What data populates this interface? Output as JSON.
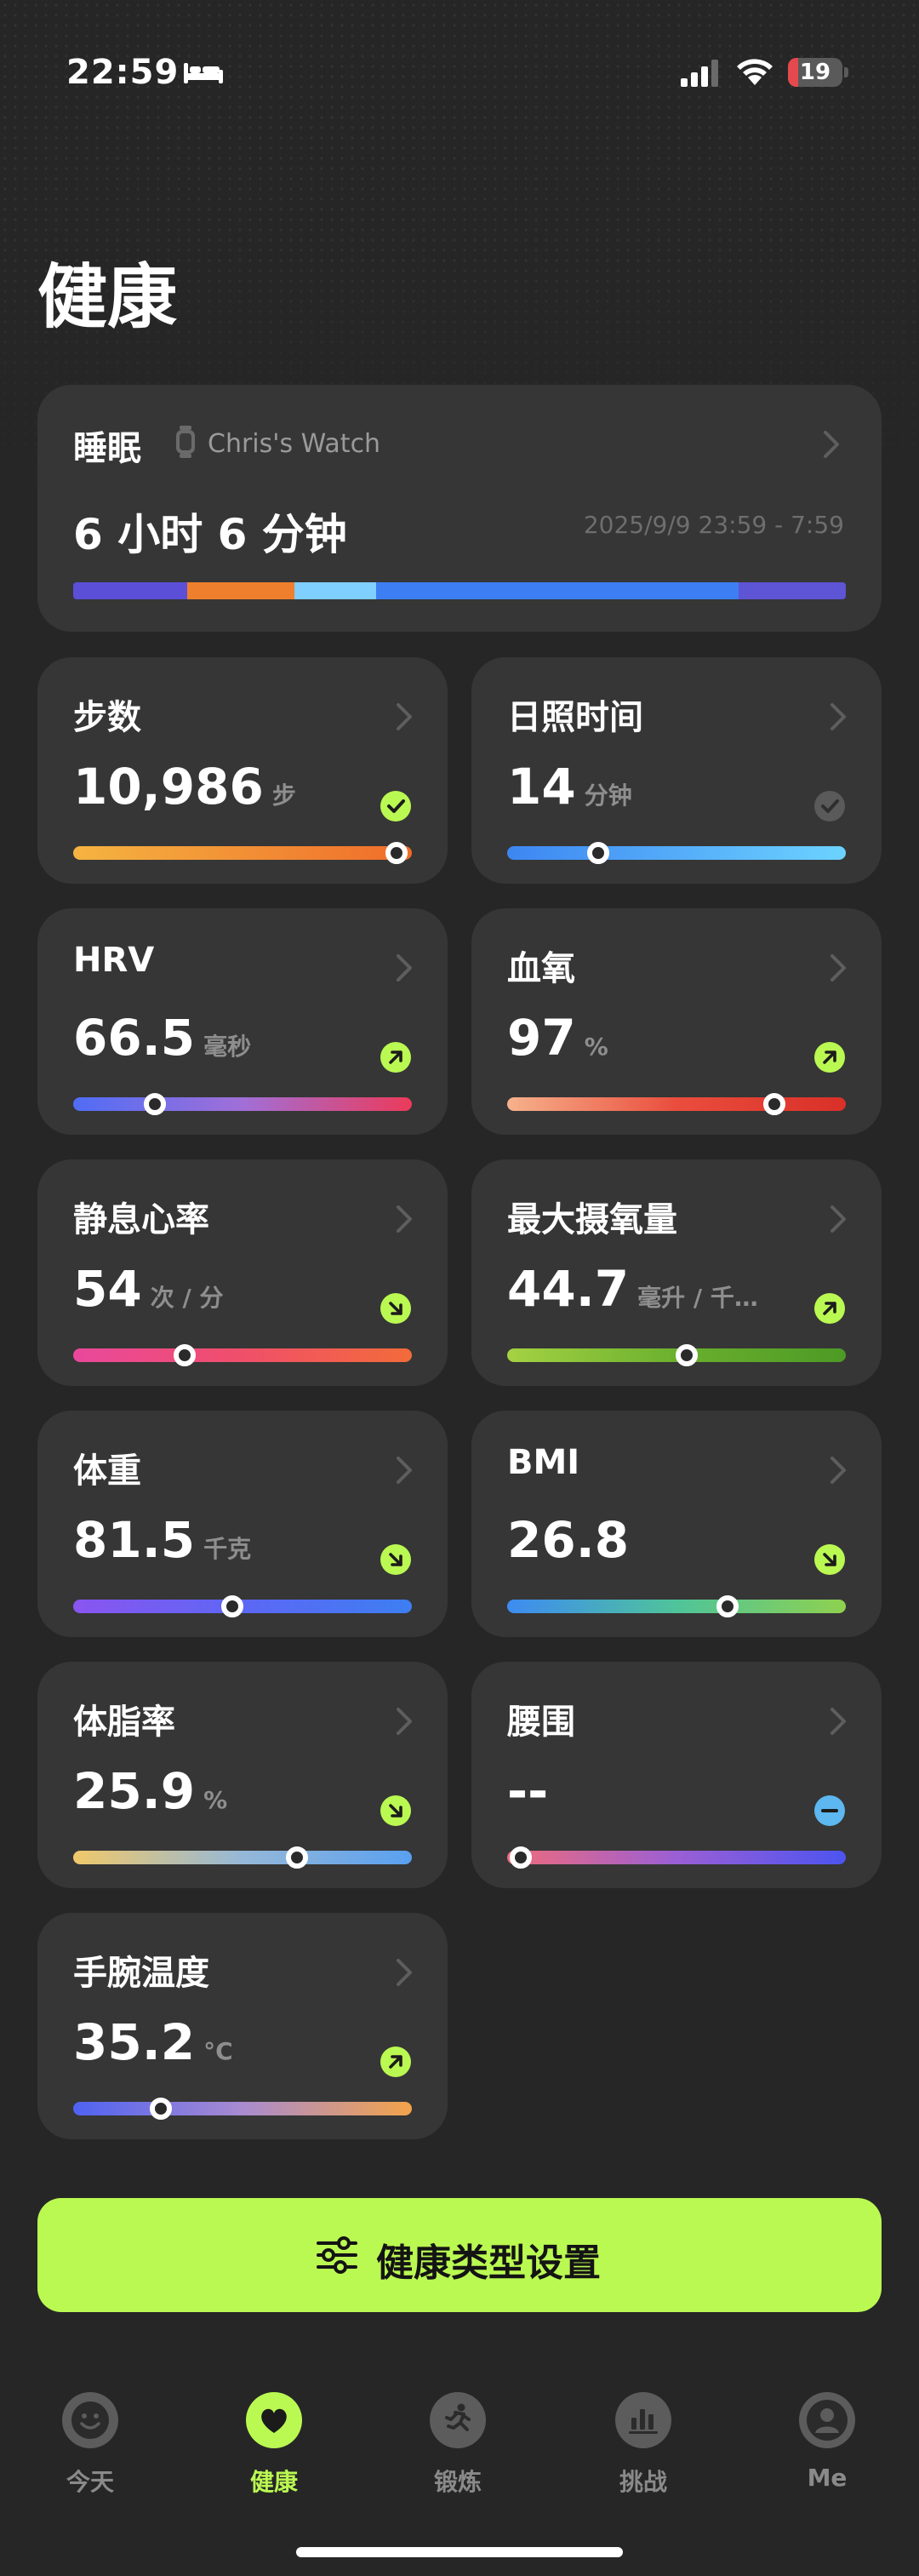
{
  "status_bar": {
    "time": "22:59",
    "battery": "19",
    "battery_level": 0.19
  },
  "page": {
    "title": "健康"
  },
  "sleep": {
    "title": "睡眠",
    "device": "Chris's Watch",
    "value": "6 小时 6 分钟",
    "range": "2025/9/9 23:59  -  7:59",
    "segments": [
      {
        "color": "#5b4fd8",
        "fraction": 0.148
      },
      {
        "color": "#ef7f2c",
        "fraction": 0.138
      },
      {
        "color": "#7fcfff",
        "fraction": 0.106
      },
      {
        "color": "#3d7ef2",
        "fraction": 0.469
      },
      {
        "color": "#5e54d6",
        "fraction": 0.139
      }
    ]
  },
  "cards": [
    {
      "title": "步数",
      "value": "10,986",
      "unit": "步",
      "status": "check-green",
      "level": 0.955,
      "gradient": [
        "#f5b441",
        "#ef6c2a"
      ]
    },
    {
      "title": "日照时间",
      "value": "14",
      "unit": "分钟",
      "status": "check-gray",
      "level": 0.27,
      "gradient": [
        "#3d86f2",
        "#6cd3ff"
      ]
    },
    {
      "title": "HRV",
      "value": "66.5",
      "unit": "毫秒",
      "status": "arrow-up",
      "level": 0.24,
      "gradient": [
        "#4f6df5",
        "#a16fd8",
        "#ec3a5a"
      ]
    },
    {
      "title": "血氧",
      "value": "97",
      "unit": "%",
      "status": "arrow-up",
      "level": 0.79,
      "gradient": [
        "#f6b28c",
        "#ea4d3d",
        "#d93028"
      ]
    },
    {
      "title": "静息心率",
      "value": "54",
      "unit": "次 / 分",
      "status": "arrow-down",
      "level": 0.33,
      "gradient": [
        "#e9489c",
        "#f04f6a",
        "#f36b3a"
      ]
    },
    {
      "title": "最大摄氧量",
      "value": "44.7",
      "unit": "毫升 / 千…",
      "status": "arrow-up",
      "level": 0.53,
      "gradient": [
        "#a4d243",
        "#6bb02e",
        "#4c9a25"
      ]
    },
    {
      "title": "体重",
      "value": "81.5",
      "unit": "千克",
      "status": "arrow-down",
      "level": 0.47,
      "gradient": [
        "#8a55f0",
        "#5d67f4",
        "#3d7ef2"
      ]
    },
    {
      "title": "BMI",
      "value": "26.8",
      "unit": "",
      "status": "arrow-down",
      "level": 0.65,
      "gradient": [
        "#3d8bf2",
        "#4fc49a",
        "#8fd14f"
      ]
    },
    {
      "title": "体脂率",
      "value": "25.9",
      "unit": "%",
      "status": "arrow-down",
      "level": 0.66,
      "gradient": [
        "#f0c86a",
        "#95b8d8",
        "#5aa0f0"
      ]
    },
    {
      "title": "腰围",
      "value": "--",
      "unit": "",
      "status": "minus-blue",
      "level": 0.04,
      "gradient": [
        "#f06b7a",
        "#9a5fd5",
        "#4d54f0"
      ]
    },
    {
      "title": "手腕温度",
      "value": "35.2",
      "unit": "°C",
      "status": "arrow-up",
      "level": 0.26,
      "gradient": [
        "#4f62f2",
        "#a98bd0",
        "#f3a34a"
      ]
    }
  ],
  "cta": {
    "label": "健康类型设置"
  },
  "tabs": [
    {
      "label": "今天",
      "icon": "smiley-icon"
    },
    {
      "label": "健康",
      "icon": "heart-icon"
    },
    {
      "label": "锻炼",
      "icon": "running-icon"
    },
    {
      "label": "挑战",
      "icon": "bar-chart-icon"
    },
    {
      "label": "Me",
      "icon": "person-icon"
    }
  ],
  "colors": {
    "accent": "#baf952",
    "card": "#363636",
    "background": "#262626"
  }
}
